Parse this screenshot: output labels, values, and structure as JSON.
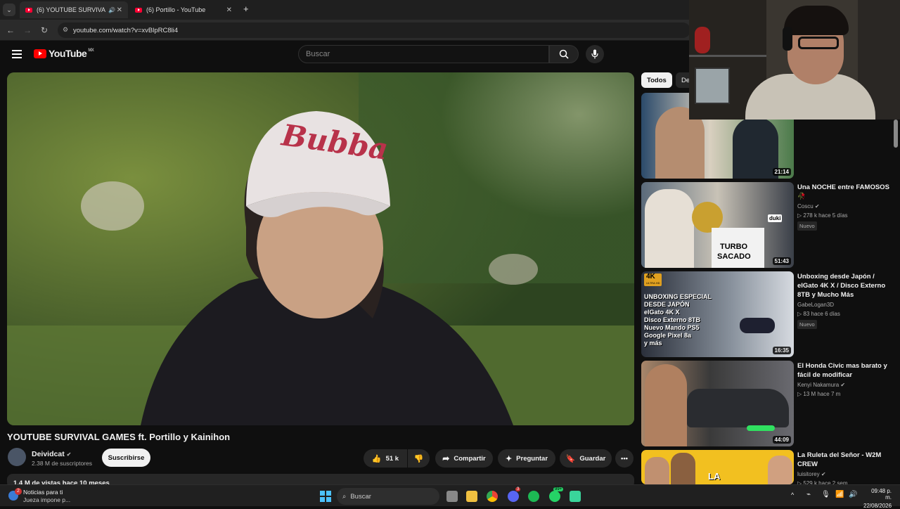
{
  "browser": {
    "tabs": [
      {
        "title": "(6) YOUTUBE SURVIVAL GA..."
      },
      {
        "title": "(6) Portillo - YouTube"
      }
    ],
    "new_tab": "+",
    "url": "youtube.com/watch?v=xvBlpRC8li4"
  },
  "yt": {
    "logo": "YouTube",
    "region": "MX",
    "search_placeholder": "Buscar"
  },
  "video": {
    "cap_text": "Bubba",
    "title": "YOUTUBE SURVIVAL GAMES ft. Portillo y Kainihon",
    "channel": "Deividcat",
    "subscribers": "2.38 M de suscriptores",
    "subscribe": "Suscribirse",
    "likes": "51 k",
    "share": "Compartir",
    "ask": "Preguntar",
    "save": "Guardar",
    "stats": "1.4 M de vistas  hace 10 meses"
  },
  "chips": [
    "Todos",
    "De"
  ],
  "related": [
    {
      "title": "",
      "channel": "",
      "meta": "",
      "badge": "",
      "duration": "21:14"
    },
    {
      "title": "Una NOCHE entre FAMOSOS 🥀",
      "channel": "Coscu",
      "meta": "▷ 278 k  hace 5 días",
      "badge": "Nuevo",
      "duration": "51:43",
      "thumb_text": [
        "duki",
        "TURBO",
        "SACADO"
      ]
    },
    {
      "title": "Unboxing desde Japón / elGato 4K X / Disco Externo 8TB y Mucho Más",
      "channel": "GabeLogan3D",
      "meta": "▷ 83  hace 6 días",
      "badge": "Nuevo",
      "duration": "16:35",
      "thumb_text": [
        "4K",
        "ULTRA HD",
        "UNBOXING ESPECIAL",
        "DESDE JAPÓN",
        "elGato 4K X",
        "Disco Externo 8TB",
        "Nuevo Mando PS5",
        "Google Pixel 8a",
        "y más"
      ]
    },
    {
      "title": "El Honda Civic mas barato y fácil de modificar",
      "channel": "Kenyi Nakamura",
      "meta": "▷ 13 M  hace 7 m",
      "badge": "",
      "duration": "44:09"
    },
    {
      "title": "La Ruleta del Señor - W2M CREW",
      "channel": "luisitorey",
      "meta": "▷ 529 k  hace 2 sem",
      "badge": "",
      "duration": "",
      "thumb_text": [
        "LA"
      ]
    }
  ],
  "taskbar": {
    "news_title": "Noticias para ti",
    "news_sub": "Jueza impone p...",
    "news_badge": "2",
    "search": "Buscar",
    "badge_discord": "3",
    "badge_whatsapp": "99+",
    "time": "09:48 p. m.",
    "date": "22/08/2026"
  },
  "colors": {
    "yt_red": "#ff0000",
    "bg": "#0f0f0f",
    "chip_bg": "#272727"
  }
}
